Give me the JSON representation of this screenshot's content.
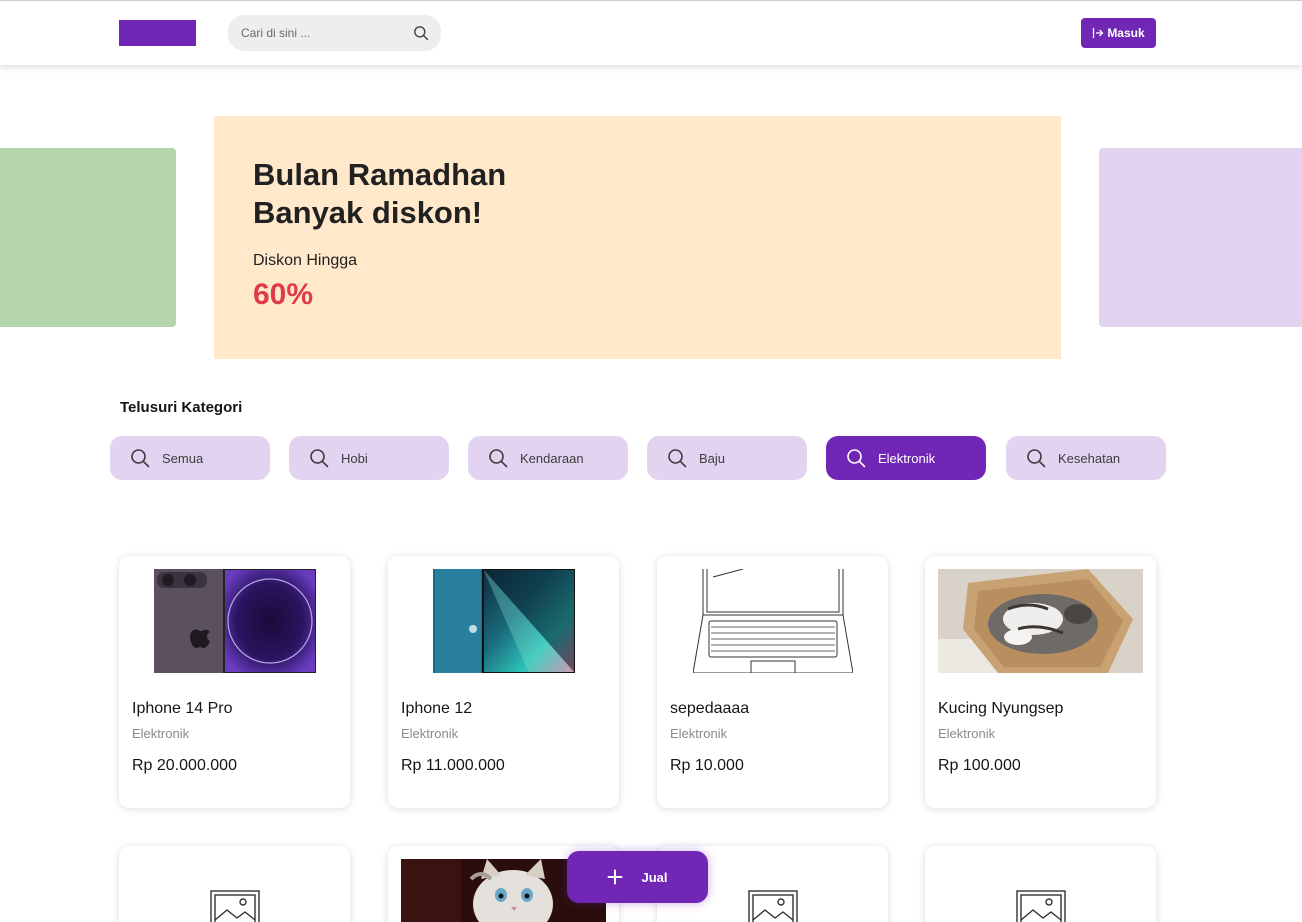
{
  "header": {
    "search_placeholder": "Cari di sini ...",
    "login_label": "Masuk"
  },
  "banner": {
    "title_line1": "Bulan Ramadhan",
    "title_line2": "Banyak diskon!",
    "subtitle": "Diskon Hingga",
    "discount": "60%"
  },
  "categories": {
    "title": "Telusuri Kategori",
    "items": [
      {
        "label": "Semua",
        "active": false
      },
      {
        "label": "Hobi",
        "active": false
      },
      {
        "label": "Kendaraan",
        "active": false
      },
      {
        "label": "Baju",
        "active": false
      },
      {
        "label": "Elektronik",
        "active": true
      },
      {
        "label": "Kesehatan",
        "active": false
      }
    ]
  },
  "products": [
    {
      "name": "Iphone 14 Pro",
      "category": "Elektronik",
      "price": "Rp 20.000.000",
      "image": "phone-purple"
    },
    {
      "name": "Iphone 12",
      "category": "Elektronik",
      "price": "Rp 11.000.000",
      "image": "phone-blue"
    },
    {
      "name": "sepedaaaa",
      "category": "Elektronik",
      "price": "Rp 10.000",
      "image": "laptop-sketch"
    },
    {
      "name": "Kucing Nyungsep",
      "category": "Elektronik",
      "price": "Rp 100.000",
      "image": "cat-in-box"
    }
  ],
  "products_row2": [
    {
      "image": "placeholder-image-icon"
    },
    {
      "image": "kitten-photo"
    },
    {
      "image": "placeholder-image-icon"
    },
    {
      "image": "placeholder-image-icon"
    }
  ],
  "fab": {
    "label": "Jual"
  },
  "colors": {
    "primary": "#7126b5",
    "primary_light": "#e2d4f0",
    "banner_bg": "#ffe9ca",
    "discount": "#e03a4a",
    "side_green": "#b4d4ab"
  }
}
